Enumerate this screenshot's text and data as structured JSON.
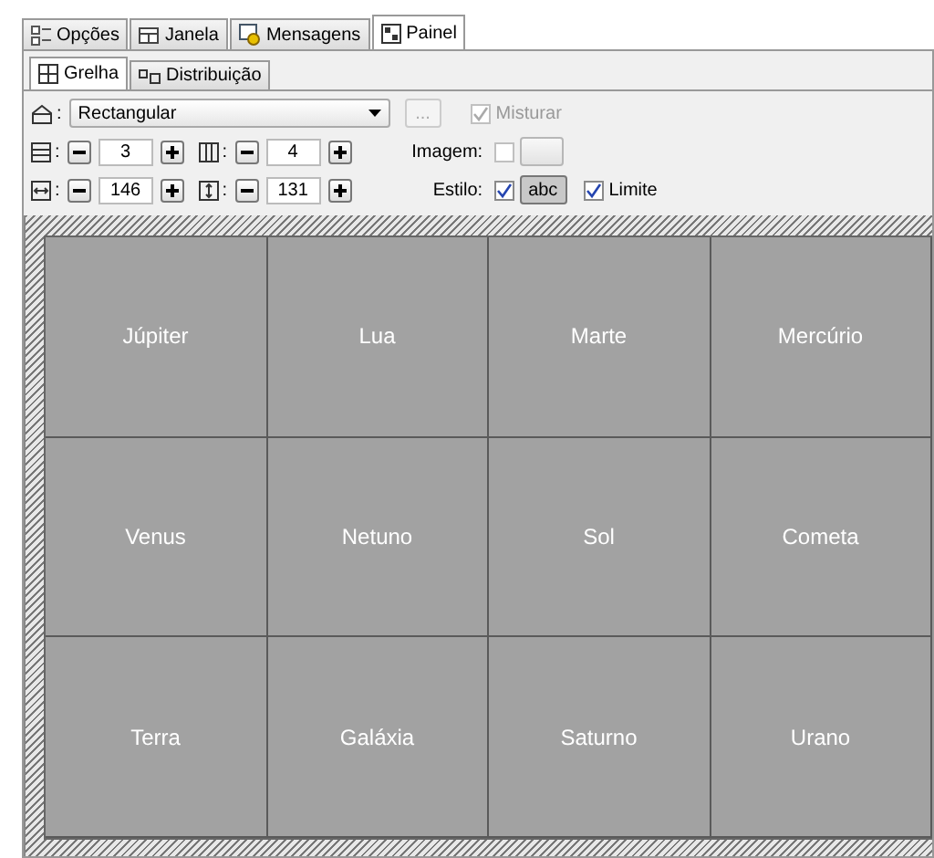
{
  "tabs": [
    {
      "label": "Opções",
      "selected": false
    },
    {
      "label": "Janela",
      "selected": false
    },
    {
      "label": "Mensagens",
      "selected": false
    },
    {
      "label": "Painel",
      "selected": true
    }
  ],
  "subtabs": [
    {
      "label": "Grelha",
      "selected": true
    },
    {
      "label": "Distribuição",
      "selected": false
    }
  ],
  "shape": {
    "colon": ":",
    "value": "Rectangular",
    "more": "...",
    "mix": {
      "label": "Misturar",
      "checked": true,
      "disabled": true
    }
  },
  "rows_spinner": {
    "colon": ":",
    "value": "3"
  },
  "cols_spinner": {
    "colon": ":",
    "value": "4"
  },
  "width_spinner": {
    "colon": ":",
    "value": "146"
  },
  "height_spinner": {
    "colon": ":",
    "value": "131"
  },
  "image": {
    "label": "Imagem:",
    "checked": false,
    "disabled": true
  },
  "style": {
    "label": "Estilo:",
    "checked": true,
    "sample": "abc",
    "pressed": true
  },
  "limit": {
    "label": "Limite",
    "checked": true
  },
  "cells": [
    "Júpiter",
    "Lua",
    "Marte",
    "Mercúrio",
    "Venus",
    "Netuno",
    "Sol",
    "Cometa",
    "Terra",
    "Galáxia",
    "Saturno",
    "Urano"
  ]
}
